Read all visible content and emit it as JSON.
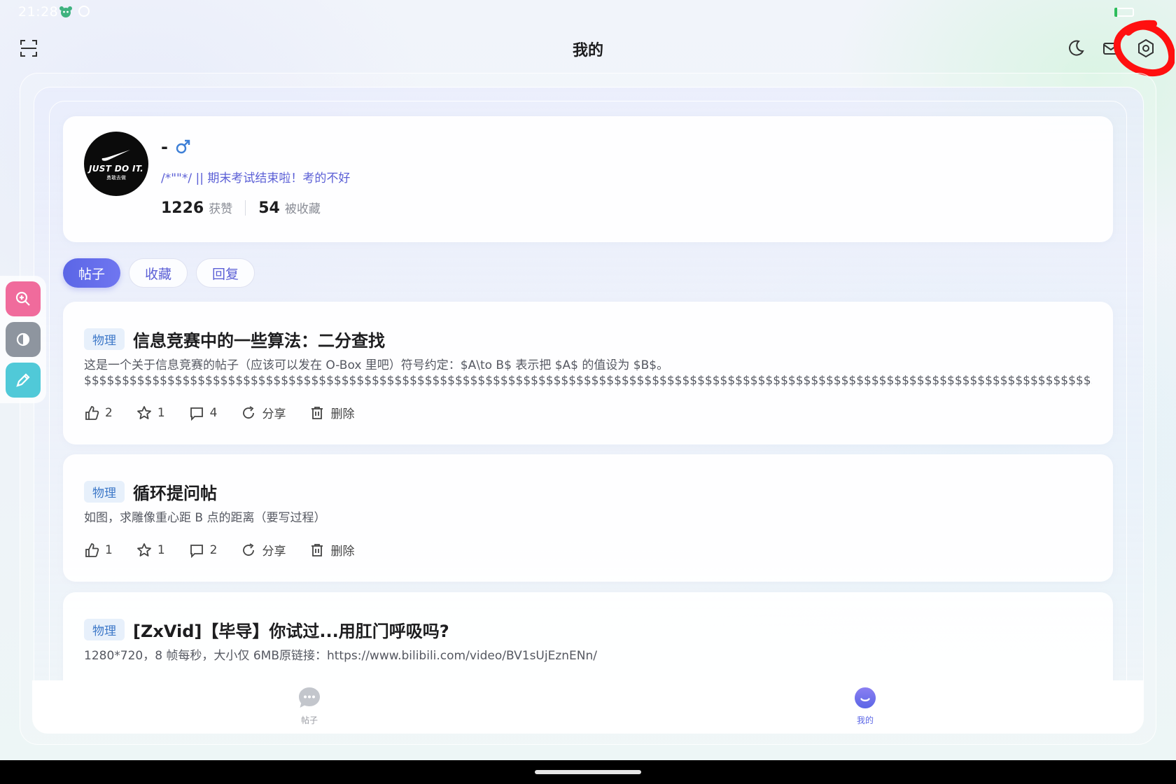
{
  "status_bar": {
    "time": "21:28"
  },
  "header": {
    "title": "我的"
  },
  "icons": {
    "scan": "scan-icon",
    "dark_mode": "moon-icon",
    "messages": "mail-icon",
    "settings": "settings-icon"
  },
  "profile": {
    "avatar_text": "JUST DO IT.",
    "avatar_subtext": "勇敢去做",
    "name": "-",
    "bio": "/*\"\"*/ || 期末考试结束啦！考的不好",
    "likes_count": "1226",
    "likes_label": "获赞",
    "favorited_count": "54",
    "favorited_label": "被收藏"
  },
  "tabs": [
    {
      "label": "帖子",
      "active": true
    },
    {
      "label": "收藏",
      "active": false
    },
    {
      "label": "回复",
      "active": false
    }
  ],
  "posts": [
    {
      "tag": "物理",
      "title": "信息竞赛中的一些算法：二分查找",
      "summary": "这是一个关于信息竞赛的帖子（应该可以发在 O-Box 里吧）符号约定：$A\\to B$ 表示把 $A$ 的值设为 $B$。$$$$$$$$$$$$$$$$$$$$$$$$$$$$$$$$$$$$$$$$$$$$$$$$$$$$$$$$$$$$$$$$$$$$$$$$$$$$$$$$$$$$$$$$$$$$$$$$$$$$$$$$$$$$$$$$$$$$$$$$$$$$$$$$$$$$$$$$$$$$$$$$$$$$$$$$$$$$$$$$$$$$$$$$$$$$$$$$$$$$$$$$$$$$$$$$$$$$$$$$$$$$$$$$$$$$$$$$$$$$$$$$$$$$$$$$$$$$$$$$$$$$$$$$$$$$$$$$$$$$$$$$$$$$$$$$$$$$$$$$$$$$$$$$$$$$$$$...",
      "likes": "2",
      "favorites": "1",
      "comments": "4",
      "share_label": "分享",
      "delete_label": "删除"
    },
    {
      "tag": "物理",
      "title": "循环提问帖",
      "summary": "如图，求雕像重心距 B 点的距离（要写过程）",
      "likes": "1",
      "favorites": "1",
      "comments": "2",
      "share_label": "分享",
      "delete_label": "删除"
    },
    {
      "tag": "物理",
      "title": "[ZxVid]【毕导】你试过...用肛门呼吸吗?",
      "summary": "1280*720，8 帧每秒，大小仅 6MB原链接：https://www.bilibili.com/video/BV1sUjEznENn/"
    }
  ],
  "bottom_nav": {
    "posts_label": "帖子",
    "mine_label": "我的"
  },
  "colors": {
    "accent": "#5b66e6",
    "tag_bg": "#e7f0fb",
    "tag_text": "#3d78c8",
    "bio_text": "#5b5fd6",
    "annotation": "#ff0000"
  }
}
